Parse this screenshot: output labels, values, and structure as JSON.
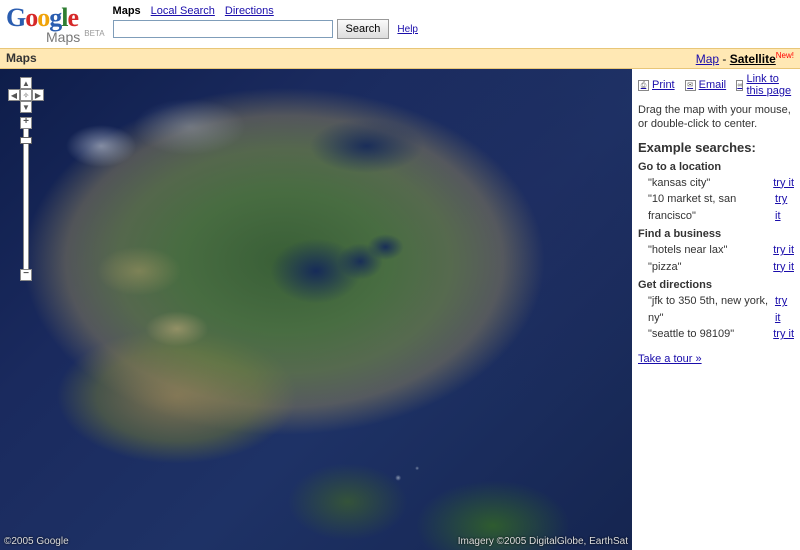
{
  "header": {
    "logo_maps": "Maps",
    "logo_beta": "BETA",
    "tabs": {
      "maps": "Maps",
      "local": "Local Search",
      "directions": "Directions"
    },
    "search_button": "Search",
    "help": "Help"
  },
  "bar": {
    "title": "Maps",
    "map_link": "Map",
    "satellite_link": "Satellite",
    "new_tag": "New!"
  },
  "controls": {
    "pan_n": "▲",
    "pan_s": "▼",
    "pan_e": "▶",
    "pan_w": "◀",
    "pan_c": "✧",
    "zoom_in": "+",
    "zoom_out": "−"
  },
  "attrib": {
    "left": "©2005 Google",
    "right": "Imagery ©2005 DigitalGlobe, EarthSat"
  },
  "sidebar": {
    "actions": {
      "print": "Print",
      "email": "Email",
      "link": "Link to this page"
    },
    "hint": "Drag the map with your mouse, or double-click to center.",
    "examples_title": "Example searches:",
    "sections": [
      {
        "title": "Go to a location",
        "items": [
          {
            "q": "\"kansas city\"",
            "a": "try it"
          },
          {
            "q": "\"10 market st, san francisco\"",
            "a": "try it"
          }
        ]
      },
      {
        "title": "Find a business",
        "items": [
          {
            "q": "\"hotels near lax\"",
            "a": "try it"
          },
          {
            "q": "\"pizza\"",
            "a": "try it"
          }
        ]
      },
      {
        "title": "Get directions",
        "items": [
          {
            "q": "\"jfk to 350 5th, new york, ny\"",
            "a": "try it"
          },
          {
            "q": "\"seattle to 98109\"",
            "a": "try it"
          }
        ]
      }
    ],
    "tour": "Take a tour »"
  }
}
